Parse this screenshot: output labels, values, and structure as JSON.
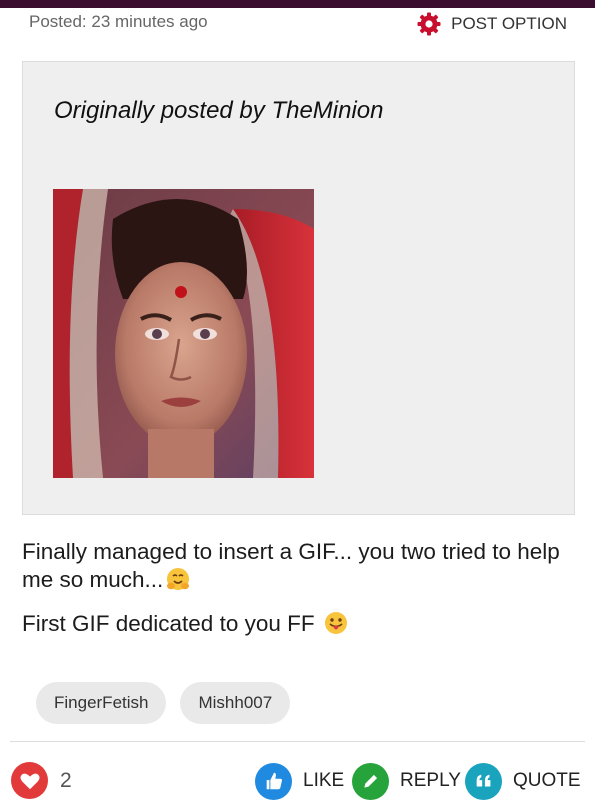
{
  "post": {
    "meta": "Posted: 23 minutes ago",
    "option_label": "POST OPTION"
  },
  "quote": {
    "author_line": "Originally posted by TheMinion",
    "image_desc": "animated-gif"
  },
  "content": {
    "line1": "Finally managed to insert a GIF... you two tried to help me so much...",
    "line2": "First GIF dedicated to you FF"
  },
  "tags": [
    "FingerFetish",
    "Mishh007"
  ],
  "actions": {
    "like_count": "2",
    "like_label": "LIKE",
    "reply_label": "REPLY",
    "quote_label": "QUOTE"
  },
  "colors": {
    "top_strip": "#3b0d2e",
    "accent_gear": "#c8102e",
    "heart": "#e23a3a",
    "like": "#1f8ae0",
    "reply": "#27a33b",
    "quote": "#1aa3bd"
  },
  "icons": {
    "gear": "gear-icon",
    "heart": "heart-icon",
    "like": "thumbs-up-icon",
    "reply": "pencil-icon",
    "quote": "quote-icon",
    "emoji1": "hugging-face-emoji",
    "emoji2": "tongue-out-emoji"
  }
}
